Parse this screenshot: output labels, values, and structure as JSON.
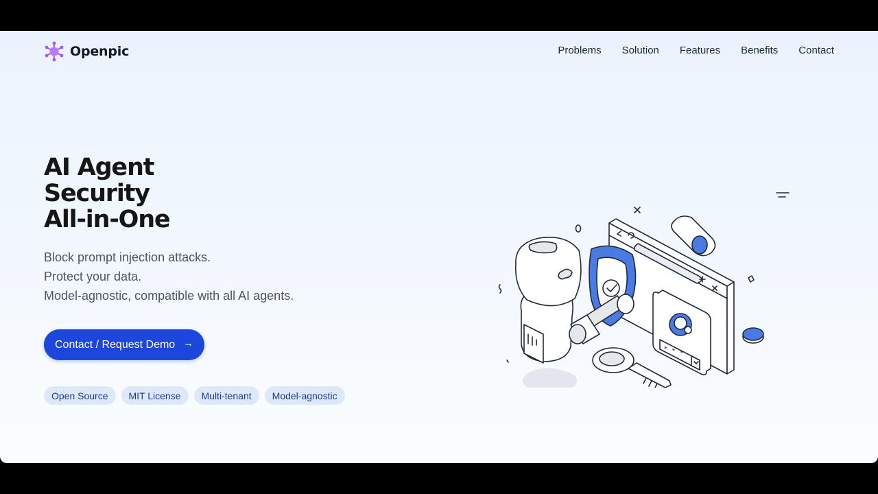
{
  "brand": {
    "name": "Openpic",
    "logo_icon": "virus-logo-icon",
    "logo_color": "#a855f7"
  },
  "nav": {
    "links": [
      "Problems",
      "Solution",
      "Features",
      "Benefits",
      "Contact"
    ]
  },
  "hero": {
    "title_lines": [
      "AI Agent",
      "Security",
      "All-in-One"
    ],
    "subtitle_lines": [
      "Block prompt injection attacks.",
      "Protect your data.",
      "Model-agnostic, compatible with all AI agents."
    ],
    "cta_label": "Contact / Request Demo",
    "cta_icon": "arrow-right-icon",
    "tags": [
      "Open Source",
      "MIT License",
      "Multi-tenant",
      "Model-agnostic"
    ]
  },
  "colors": {
    "accent": "#1d47dc",
    "illustration_blue": "#4a7be5",
    "tag_bg": "#dde9fb",
    "tag_text": "#1e3a8a"
  },
  "login_card": {
    "password_mask": "* * *"
  }
}
